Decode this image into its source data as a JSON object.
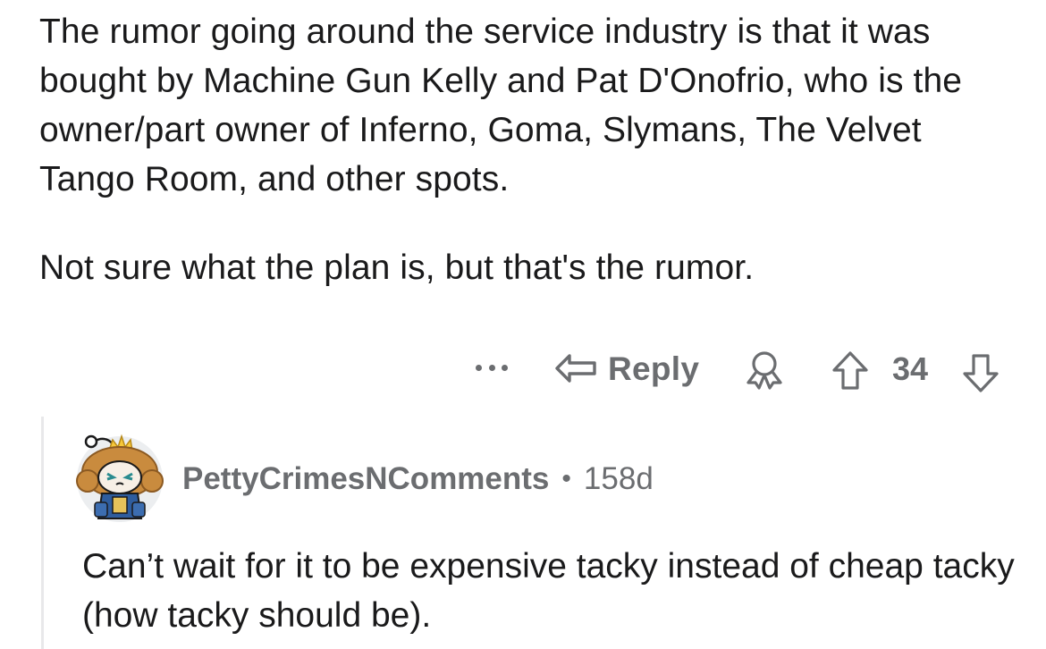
{
  "comment": {
    "paragraphs": [
      "The rumor going around the service industry is that it was bought by Machine Gun Kelly and Pat D'Onofrio, who is the owner/part owner of Inferno, Goma, Slymans, The Velvet Tango Room, and other spots.",
      "Not sure what the plan is, but that's the rumor."
    ],
    "actions": {
      "more_icon": "more-dots-icon",
      "reply_icon": "reply-arrow-icon",
      "reply_label": "Reply",
      "award_icon": "award-icon",
      "upvote_icon": "upvote-arrow-icon",
      "vote_count": "34",
      "downvote_icon": "downvote-arrow-icon"
    }
  },
  "reply": {
    "username": "PettyCrimesNComments",
    "separator": "•",
    "age": "158d",
    "text": "Can’t wait for it to be expensive tacky instead of cheap tacky (how tacky should be).",
    "avatar_icon": "snoo-avatar-icon"
  },
  "colors": {
    "text": "#1a1a1b",
    "meta": "#6b6d70",
    "thread_line": "#e8e8ea",
    "background": "#ffffff"
  }
}
